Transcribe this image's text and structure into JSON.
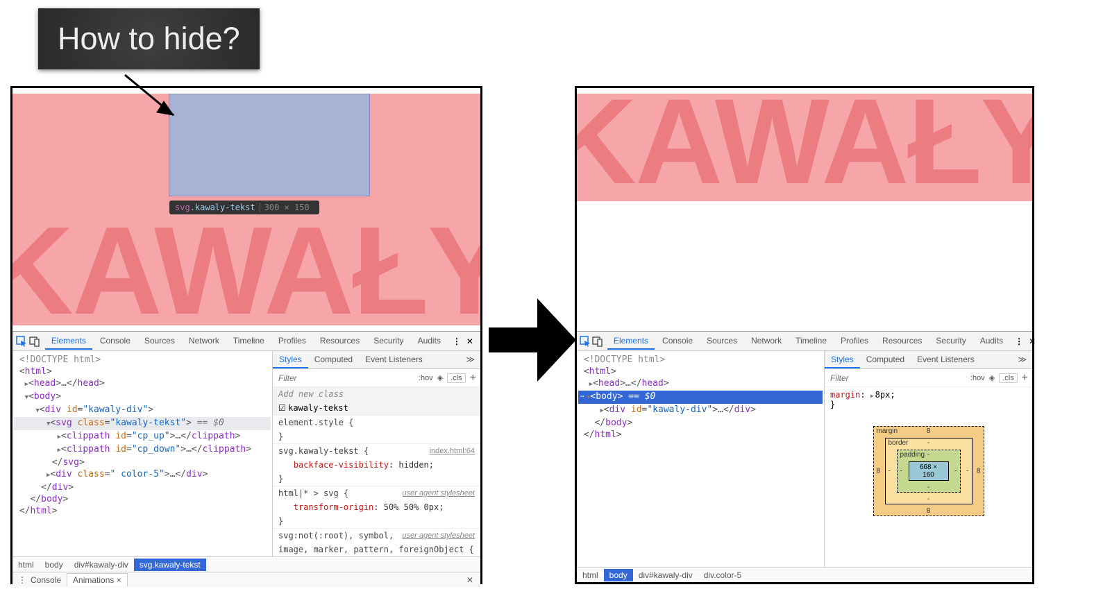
{
  "callout": {
    "text": "How to hide?"
  },
  "banner": {
    "title": "KAWAŁY"
  },
  "highlight_tooltip": {
    "tag": "svg",
    "class": ".kawaly-tekst",
    "size": "300 × 150"
  },
  "devtools": {
    "tabs": [
      "Elements",
      "Console",
      "Sources",
      "Network",
      "Timeline",
      "Profiles",
      "Resources",
      "Security",
      "Audits"
    ],
    "styles_tabs": [
      "Styles",
      "Computed",
      "Event Listeners"
    ],
    "filter_placeholder": "Filter",
    "hov": ":hov",
    "cls": ".cls",
    "addclass_placeholder": "Add new class",
    "class_checkbox": "kawaly-tekst",
    "rules": {
      "element_style_header": "element.style {",
      "element_style_close": "}",
      "rule1_sel": "svg.kawaly-tekst {",
      "rule1_src": "index.html:64",
      "rule1_prop": "backface-visibility",
      "rule1_val": ": hidden;",
      "rule1_close": "}",
      "rule2_sel": "html|* > svg {",
      "rule2_tag": "user agent stylesheet",
      "rule2_prop": "transform-origin",
      "rule2_val": ": 50% 50% 0px;",
      "rule2_close": "}",
      "rule3_line1": "svg:not(:root), symbol,",
      "rule3_tag": "user agent stylesheet",
      "rule3_line2": "image, marker, pattern, foreignObject {"
    },
    "dom_left": {
      "doctype": "<!DOCTYPE html>",
      "html_open": "<html>",
      "head": "<head>…</head>",
      "body_open": "<body>",
      "div_open": "<div id=\"kawaly-div\">",
      "svg_line_prefix": "<svg class=\"kawaly-tekst\">",
      "svg_eq": " == $0",
      "clip1": "<clippath id=\"cp_up\">…</clippath>",
      "clip2": "<clippath id=\"cp_down\">…</clippath>",
      "svg_close": "</svg>",
      "div_color": "<div class=\" color-5\">…</div>",
      "div_close": "</div>",
      "body_close": "</body>",
      "html_close": "</html>"
    },
    "crumb_left": [
      "html",
      "body",
      "div#kawaly-div",
      "svg.kawaly-tekst"
    ],
    "drawer": {
      "console": "Console",
      "anim": "Animations ×"
    }
  },
  "devtools_right_panel": {
    "dom": {
      "doctype": "<!DOCTYPE html>",
      "html_open": "<html>",
      "head": "<head>…</head>",
      "body_open": "<body>",
      "body_eq": " == $0",
      "div_line": "<div id=\"kawaly-div\">…</div>",
      "body_close": "</body>",
      "html_close": "</html>"
    },
    "style_rule": {
      "prop": "margin",
      "val": "8px;"
    },
    "crumb": [
      "html",
      "body",
      "div#kawaly-div",
      "div.color-5"
    ],
    "boxmodel": {
      "margin_label": "margin",
      "border_label": "border",
      "padding_label": "padding",
      "margin_num": "8",
      "border_num": "-",
      "padding_num": "-",
      "content": "668 × 160"
    }
  }
}
